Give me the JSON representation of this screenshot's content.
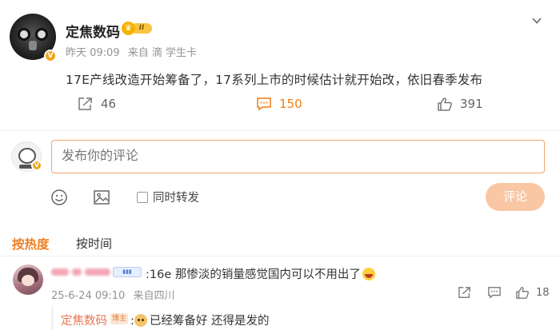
{
  "post": {
    "username": "定焦数码",
    "rank_label": "II",
    "time": "昨天 09:09",
    "source": "来自 滴 学生卡",
    "text": "17E产线改造开始筹备了，17系列上市的时候估计就开始改，依旧春季发布",
    "repost_count": "46",
    "comment_count": "150",
    "like_count": "391"
  },
  "composer": {
    "placeholder": "发布你的评论",
    "sync_label": "同时转发",
    "submit_label": "评论"
  },
  "sort": {
    "hot_label": "按热度",
    "time_label": "按时间"
  },
  "comments": [
    {
      "text": ":16e 那惨淡的销量感觉国内可以不用出了",
      "time": "25-6-24 09:10",
      "location": "来自四川",
      "like_count": "18",
      "reply": {
        "username": "定焦数码",
        "tag": "博主",
        "text": "已经筹备好 还得是发的"
      }
    }
  ],
  "colors": {
    "accent": "#f47d11",
    "author_name": "#eb7350",
    "input_border": "#f2a46a",
    "submit_bg": "#f9c7a4"
  },
  "icons": {
    "more": "chevron-down-icon",
    "repost": "share-icon",
    "comment": "comment-icon",
    "like": "thumbs-up-icon",
    "emoji": "emoji-icon",
    "image": "image-icon"
  }
}
